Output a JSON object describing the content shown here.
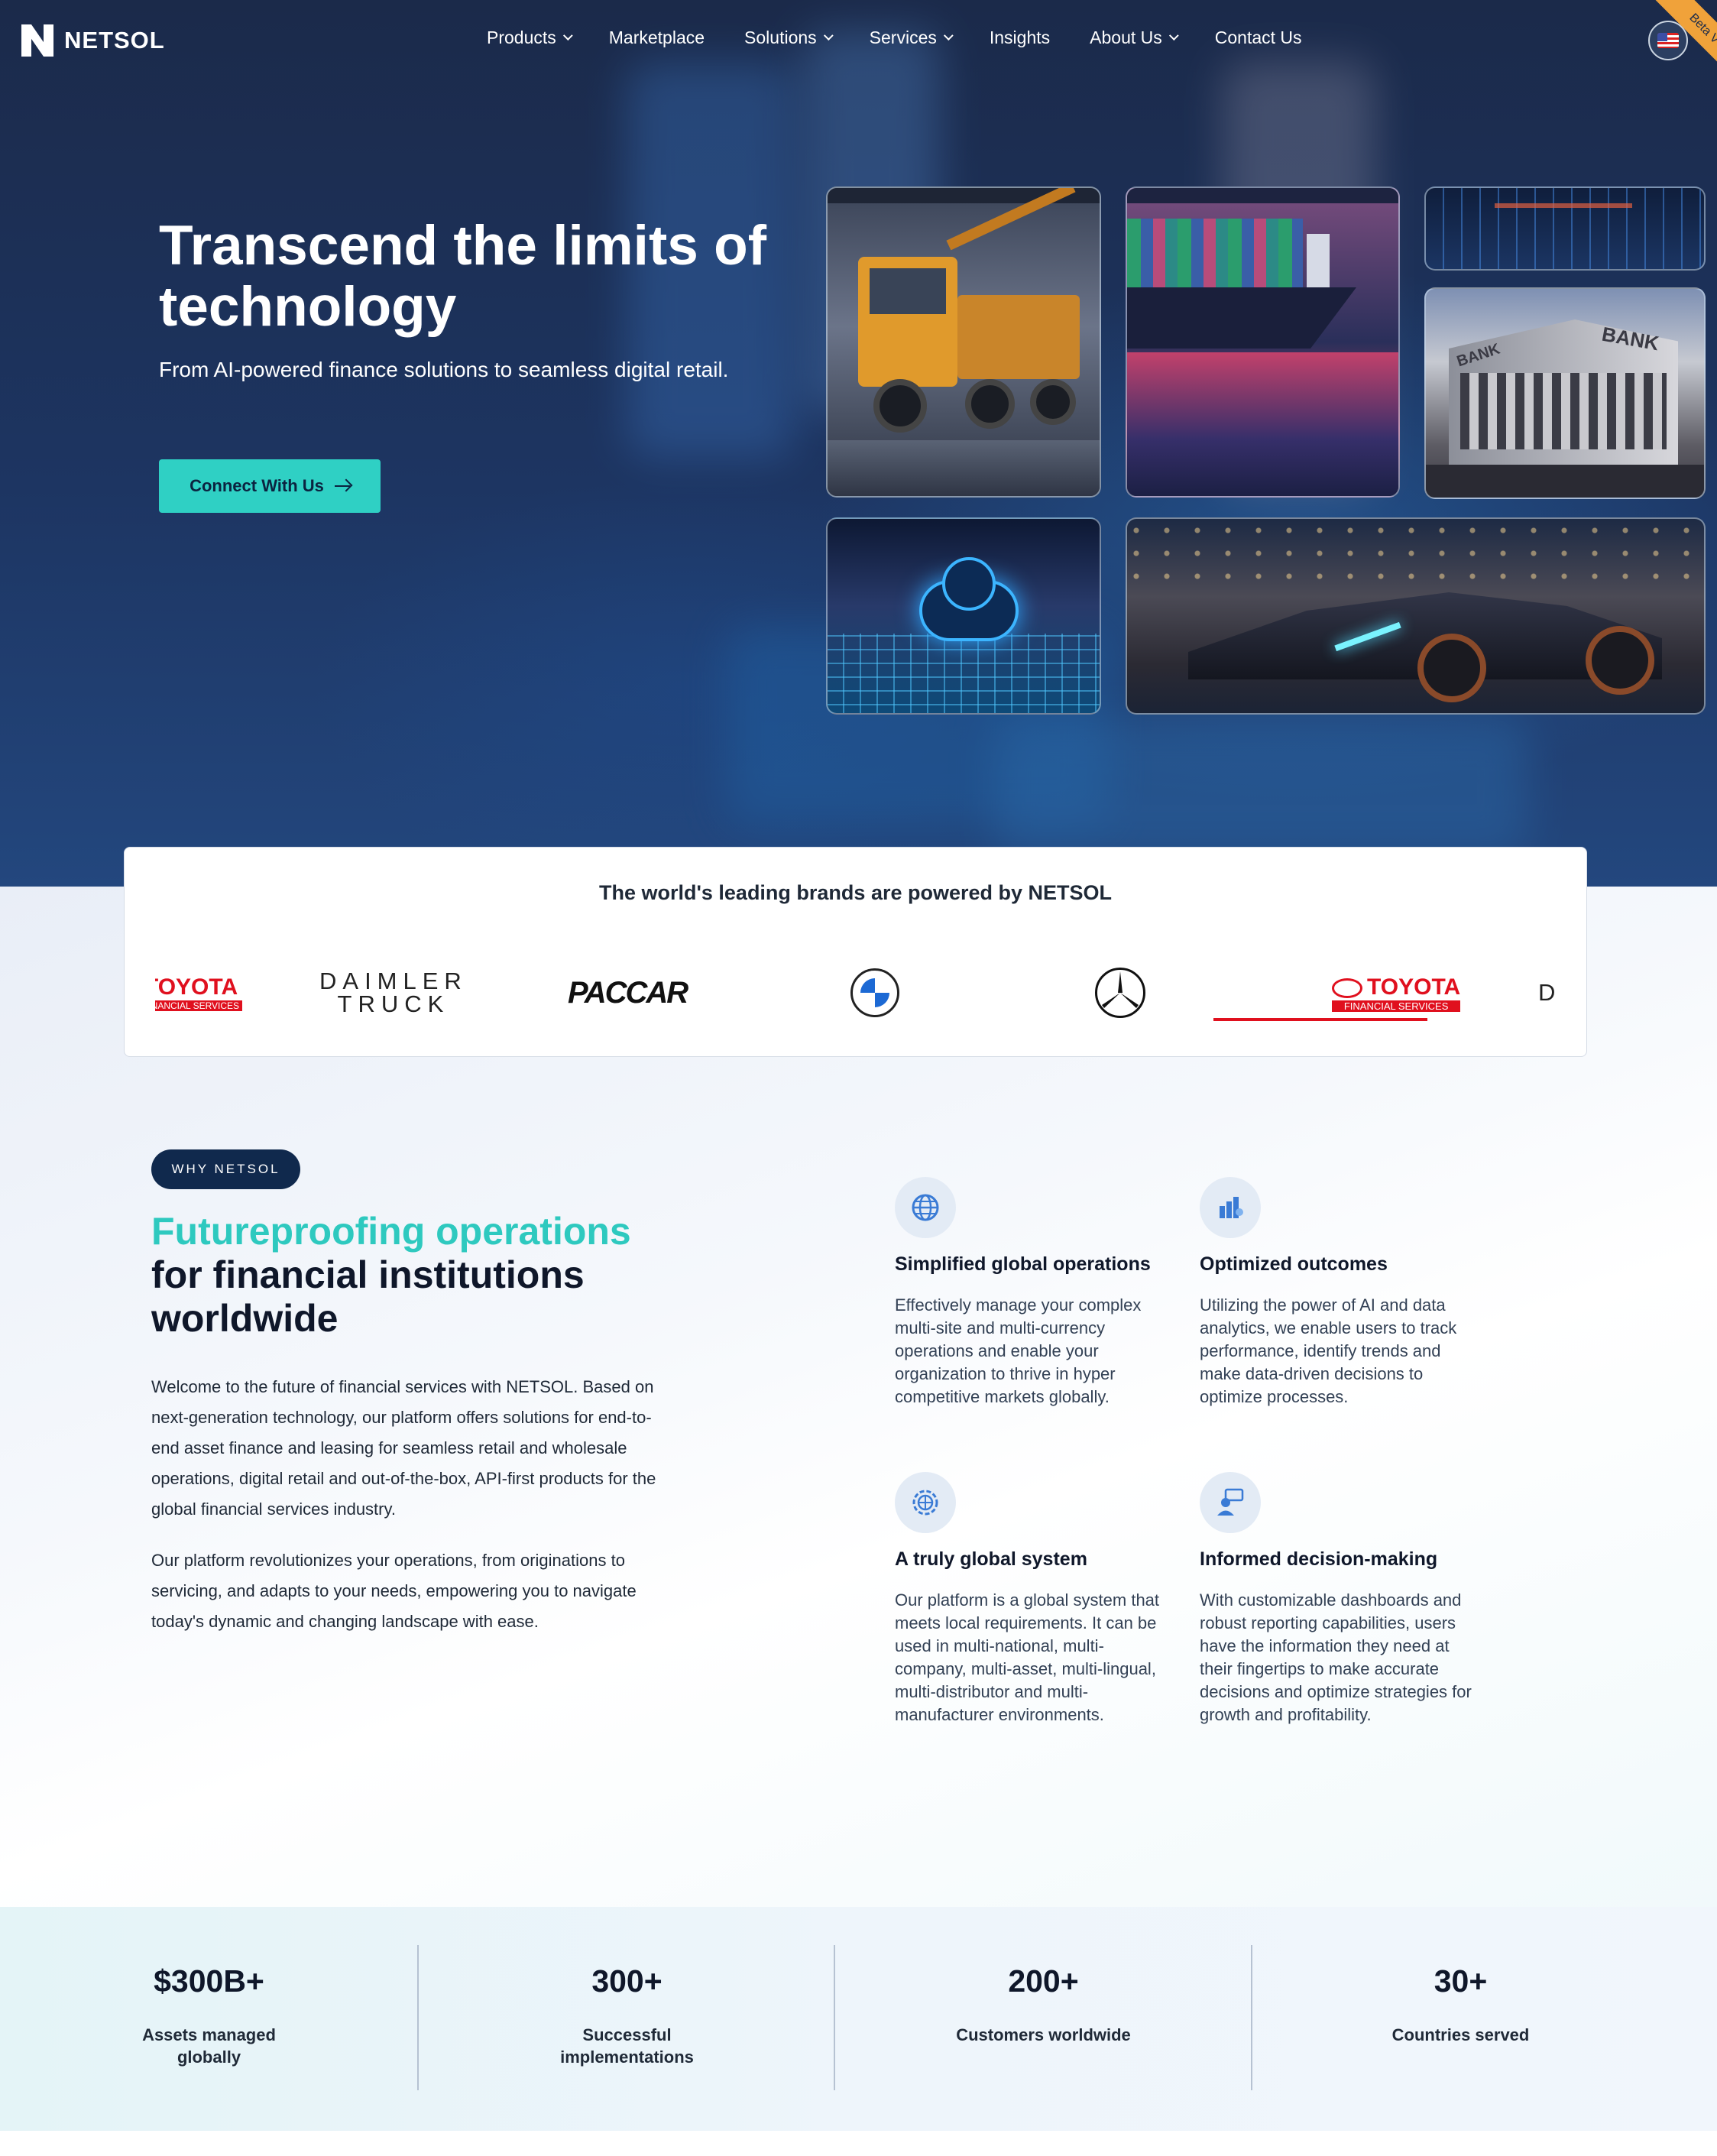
{
  "nav": {
    "brand": "NETSOL",
    "items": [
      {
        "label": "Products",
        "dropdown": true
      },
      {
        "label": "Marketplace",
        "dropdown": false
      },
      {
        "label": "Solutions",
        "dropdown": true
      },
      {
        "label": "Services",
        "dropdown": true
      },
      {
        "label": "Insights",
        "dropdown": false
      },
      {
        "label": "About Us",
        "dropdown": true
      },
      {
        "label": "Contact Us",
        "dropdown": false
      }
    ],
    "language_icon": "us-flag-icon",
    "ribbon": "Beta V"
  },
  "hero": {
    "title": "Transcend the limits of technology",
    "subtitle": "From AI-powered finance solutions to seamless digital retail.",
    "cta_label": "Connect With Us",
    "images": [
      "truck",
      "cargo-ship",
      "circuit-board",
      "bank-building",
      "cloud-network",
      "sports-car"
    ],
    "bank_sign": "BANK"
  },
  "brands": {
    "title": "The world's leading brands are powered by NETSOL",
    "logos": [
      {
        "name": "Toyota Financial Services",
        "text": "TOYOTA",
        "subtext": "FINANCIAL SERVICES"
      },
      {
        "name": "Daimler Truck",
        "text": "DAIMLER",
        "subtext": "TRUCK"
      },
      {
        "name": "PACCAR",
        "text": "PACCAR"
      },
      {
        "name": "BMW",
        "text": "B M W"
      },
      {
        "name": "Mercedes-Benz",
        "text": ""
      },
      {
        "name": "Toyota Financial Services",
        "text": "TOYOTA",
        "subtext": "FINANCIAL SERVICES"
      },
      {
        "name": "Daimler Truck",
        "text": "D"
      }
    ]
  },
  "why": {
    "pill": "WHY NETSOL",
    "title_accent": "Futureproofing operations",
    "title_rest": "for financial institutions worldwide",
    "para1": "Welcome to the future of financial services with NETSOL. Based on next-generation technology, our platform offers solutions for end-to-end asset finance and leasing for seamless retail and wholesale operations, digital retail and out-of-the-box, API-first products for the global financial services industry.",
    "para2": "Our platform revolutionizes your operations, from originations to servicing, and adapts to your needs, empowering you to navigate today's dynamic and changing landscape with ease.",
    "features": [
      {
        "icon": "globe-icon",
        "title": "Simplified global operations",
        "desc": "Effectively manage your complex multi-site and multi-currency operations and enable your organization to thrive in hyper competitive markets globally."
      },
      {
        "icon": "bar-chart-icon",
        "title": "Optimized outcomes",
        "desc": "Utilizing the power of AI and data analytics, we enable users to track performance, identify trends and make data-driven decisions to optimize processes."
      },
      {
        "icon": "global-network-icon",
        "title": "A truly global system",
        "desc": "Our platform is a global system that meets local requirements. It can be used in multi-national, multi-company, multi-asset, multi-lingual, multi-distributor and multi-manufacturer environments."
      },
      {
        "icon": "presenter-icon",
        "title": "Informed decision-making",
        "desc": "With customizable dashboards and robust reporting capabilities, users have the information they need at their fingertips to make accurate decisions and optimize strategies for growth and profitability."
      }
    ]
  },
  "stats": [
    {
      "value": "$300B+",
      "label": "Assets managed globally"
    },
    {
      "value": "300+",
      "label": "Successful implementations"
    },
    {
      "value": "200+",
      "label": "Customers worldwide"
    },
    {
      "value": "30+",
      "label": "Countries served"
    }
  ],
  "colors": {
    "hero_bg": "#1d3562",
    "accent_teal": "#2fd0c4",
    "navy": "#10294d",
    "toyota_red": "#e0101e"
  }
}
